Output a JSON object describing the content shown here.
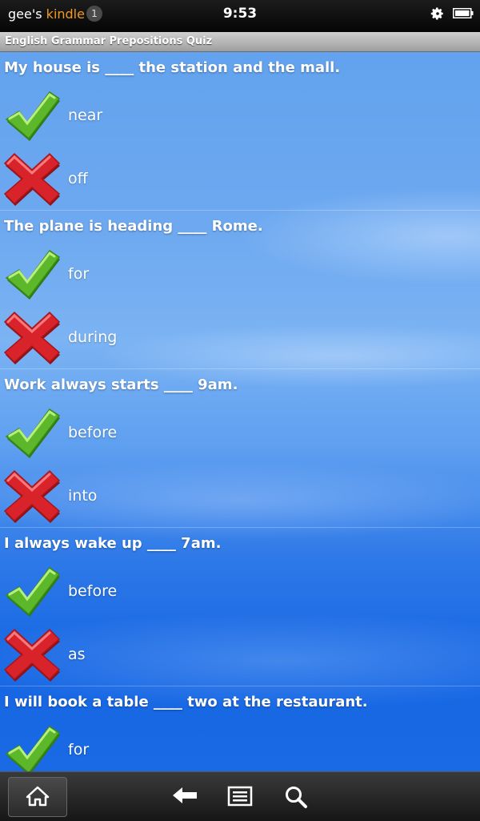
{
  "status_bar": {
    "device_name_prefix": "gee's",
    "device_name_suffix": "kindle",
    "notification_count": "1",
    "time": "9:53",
    "icons": [
      "gear-icon",
      "battery-icon"
    ]
  },
  "title_bar": {
    "title": "English Grammar Prepositions Quiz"
  },
  "quiz": {
    "questions": [
      {
        "text": "My house is ____ the station and the mall.",
        "answers": [
          {
            "label": "near",
            "status": "correct"
          },
          {
            "label": "off",
            "status": "incorrect"
          }
        ]
      },
      {
        "text": "The plane is heading ____ Rome.",
        "answers": [
          {
            "label": "for",
            "status": "correct"
          },
          {
            "label": "during",
            "status": "incorrect"
          }
        ]
      },
      {
        "text": "Work always starts ____ 9am.",
        "answers": [
          {
            "label": "before",
            "status": "correct"
          },
          {
            "label": "into",
            "status": "incorrect"
          }
        ]
      },
      {
        "text": "I always wake up ____ 7am.",
        "answers": [
          {
            "label": "before",
            "status": "correct"
          },
          {
            "label": "as",
            "status": "incorrect"
          }
        ]
      },
      {
        "text": "I will book a table ____ two at the restaurant.",
        "answers": [
          {
            "label": "for",
            "status": "correct"
          }
        ]
      }
    ]
  },
  "nav_bar": {
    "icons": [
      "home-icon",
      "back-icon",
      "menu-icon",
      "search-icon"
    ]
  },
  "colors": {
    "correct": "#5cb82a",
    "incorrect": "#d9232b",
    "accent_orange": "#f39a1e"
  }
}
